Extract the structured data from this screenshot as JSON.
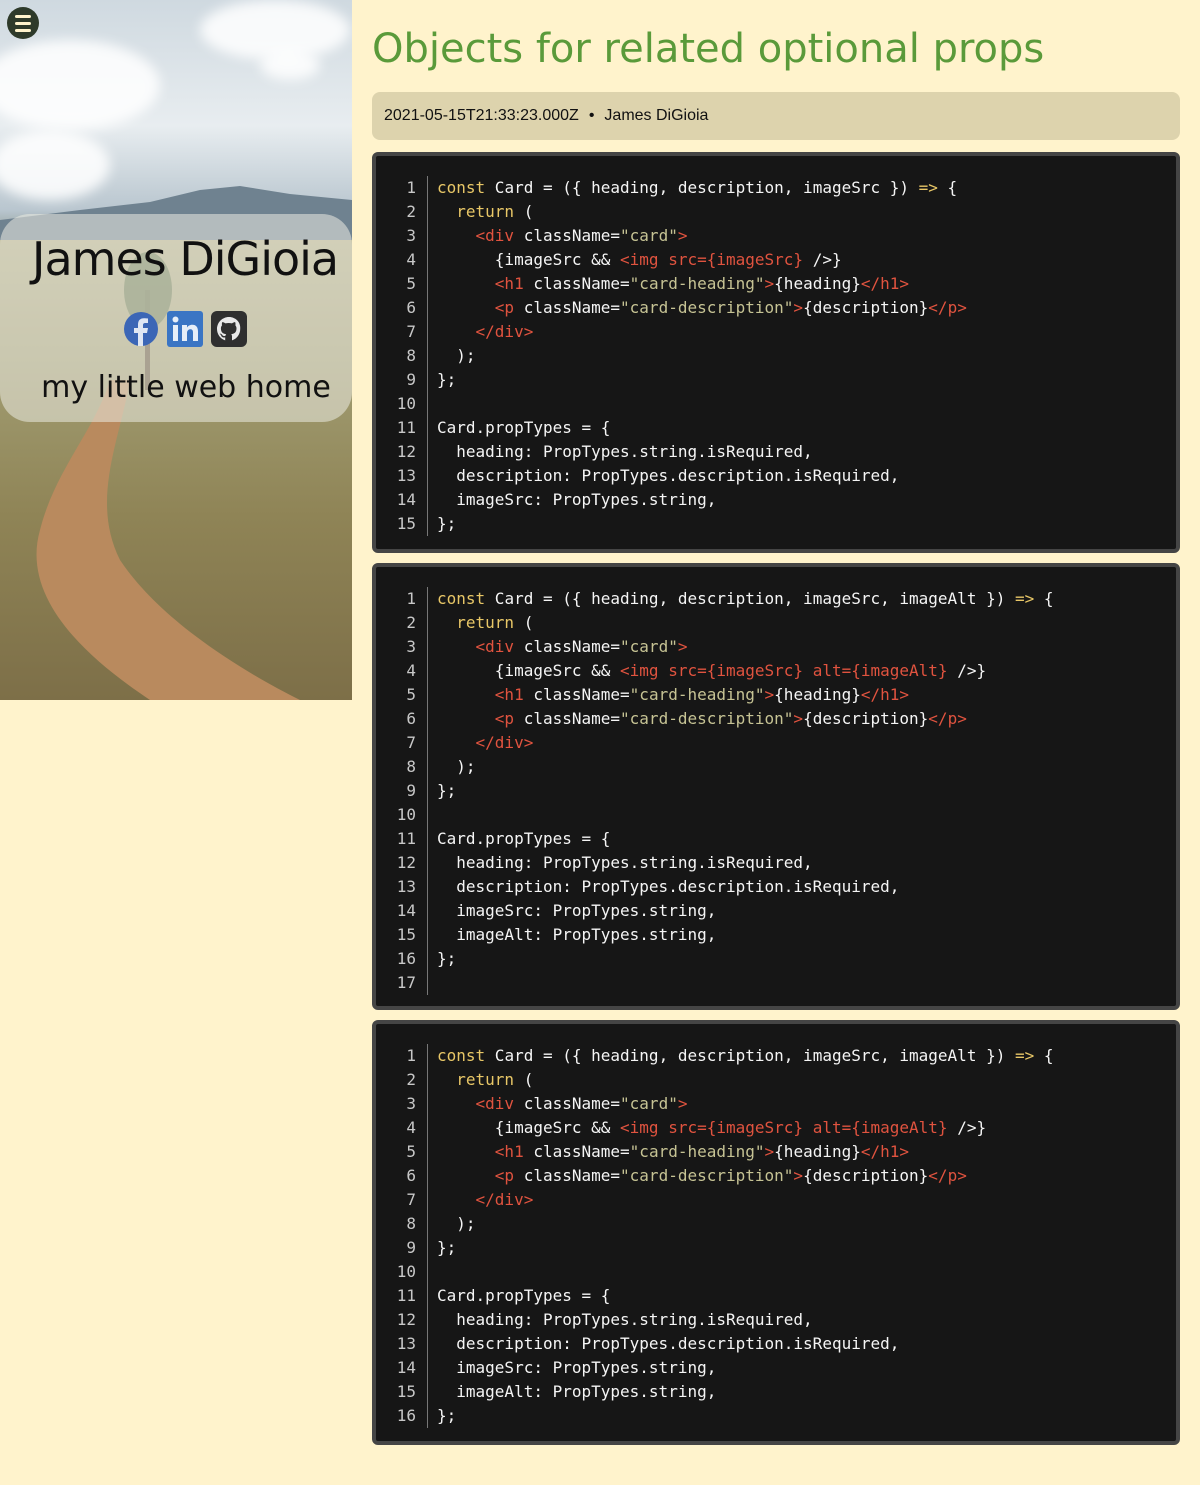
{
  "sidebar": {
    "author_name": "James DiGioia",
    "tagline": "my little web home",
    "social": [
      "facebook-icon",
      "linkedin-icon",
      "github-icon"
    ]
  },
  "post": {
    "title": "Objects for related optional props",
    "date": "2021-05-15T21:33:23.000Z",
    "separator": "•",
    "author": "James DiGioia"
  },
  "code_blocks": [
    {
      "line_numbers": [
        "1",
        "2",
        "3",
        "4",
        "5",
        "6",
        "7",
        "8",
        "9",
        "10",
        "11",
        "12",
        "13",
        "14",
        "15"
      ],
      "lines": [
        "const Card = ({ heading, description, imageSrc }) => {",
        "  return (",
        "    <div className=\"card\">",
        "      {imageSrc && <img src={imageSrc} />}",
        "      <h1 className=\"card-heading\">{heading}</h1>",
        "      <p className=\"card-description\">{description}</p>",
        "    </div>",
        "  );",
        "};",
        "",
        "Card.propTypes = {",
        "  heading: PropTypes.string.isRequired,",
        "  description: PropTypes.description.isRequired,",
        "  imageSrc: PropTypes.string,",
        "};"
      ]
    },
    {
      "line_numbers": [
        "1",
        "2",
        "3",
        "4",
        "5",
        "6",
        "7",
        "8",
        "9",
        "10",
        "11",
        "12",
        "13",
        "14",
        "15",
        "16",
        "17"
      ],
      "lines": [
        "const Card = ({ heading, description, imageSrc, imageAlt }) => {",
        "  return (",
        "    <div className=\"card\">",
        "      {imageSrc && <img src={imageSrc} alt={imageAlt} />}",
        "      <h1 className=\"card-heading\">{heading}</h1>",
        "      <p className=\"card-description\">{description}</p>",
        "    </div>",
        "  );",
        "};",
        "",
        "Card.propTypes = {",
        "  heading: PropTypes.string.isRequired,",
        "  description: PropTypes.description.isRequired,",
        "  imageSrc: PropTypes.string,",
        "  imageAlt: PropTypes.string,",
        "};",
        ""
      ]
    },
    {
      "line_numbers": [
        "1",
        "2",
        "3",
        "4",
        "5",
        "6",
        "7",
        "8",
        "9",
        "10",
        "11",
        "12",
        "13",
        "14",
        "15",
        "16"
      ],
      "lines": [
        "const Card = ({ heading, description, imageSrc, imageAlt }) => {",
        "  return (",
        "    <div className=\"card\">",
        "      {imageSrc && <img src={imageSrc} alt={imageAlt} />}",
        "      <h1 className=\"card-heading\">{heading}</h1>",
        "      <p className=\"card-description\">{description}</p>",
        "    </div>",
        "  );",
        "};",
        "",
        "Card.propTypes = {",
        "  heading: PropTypes.string.isRequired,",
        "  description: PropTypes.description.isRequired,",
        "  imageSrc: PropTypes.string,",
        "  imageAlt: PropTypes.string,",
        "};"
      ]
    }
  ],
  "colors": {
    "background": "#fff3cc",
    "title": "#5a9a3a",
    "meta_bar": "#ddd3ad",
    "code_bg": "#161616",
    "keyword": "#e8c767",
    "tag": "#e0533f",
    "string": "#c6c394"
  }
}
